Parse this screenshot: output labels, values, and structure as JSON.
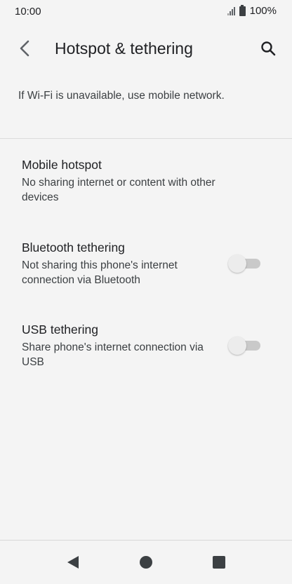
{
  "status_bar": {
    "time": "10:00",
    "battery": "100%"
  },
  "app_bar": {
    "title": "Hotspot & tethering"
  },
  "footer": {
    "text": "If Wi-Fi is unavailable, use mobile network."
  },
  "items": [
    {
      "title": "Mobile hotspot",
      "summary": "No sharing internet or content with other devices"
    },
    {
      "title": "Bluetooth tethering",
      "summary": "Not sharing this phone's internet connection via Bluetooth",
      "toggle_on": false
    },
    {
      "title": "USB tethering",
      "summary": "Share phone's internet connection via USB",
      "toggle_on": false
    }
  ],
  "icons": {
    "back": "arrow-back-icon",
    "search": "search-icon",
    "nav_back": "nav-back-triangle-icon",
    "nav_home": "nav-home-circle-icon",
    "nav_recents": "nav-recents-square-icon"
  },
  "colors": {
    "background": "#f4f4f4",
    "switch_track_off": "#c9c9c9",
    "switch_thumb_off": "#ececec"
  }
}
